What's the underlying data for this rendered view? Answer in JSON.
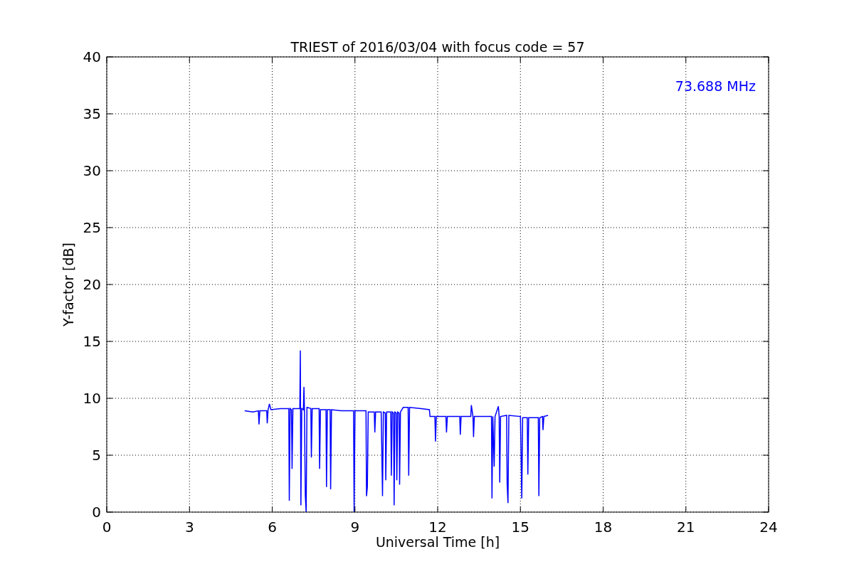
{
  "chart": {
    "chart_data": {
      "type": "line",
      "title": "TRIEST of 2016/03/04 with focus code = 57",
      "xlabel": "Universal Time [h]",
      "ylabel": "Y-factor [dB]",
      "xlim": [
        0,
        24
      ],
      "ylim": [
        0,
        40
      ],
      "xticks": [
        0,
        3,
        6,
        9,
        12,
        15,
        18,
        21,
        24
      ],
      "yticks": [
        0,
        5,
        10,
        15,
        20,
        25,
        30,
        35,
        40
      ],
      "x": [
        5.0,
        5.3,
        5.5,
        5.52,
        5.55,
        5.8,
        5.82,
        5.85,
        5.9,
        5.95,
        6.3,
        6.6,
        6.62,
        6.65,
        6.7,
        6.72,
        6.75,
        7.0,
        7.02,
        7.04,
        7.07,
        7.13,
        7.15,
        7.17,
        7.2,
        7.23,
        7.26,
        7.4,
        7.42,
        7.45,
        7.7,
        7.72,
        7.75,
        7.95,
        7.97,
        8.0,
        8.1,
        8.12,
        8.15,
        8.5,
        8.95,
        8.97,
        9.0,
        9.4,
        9.42,
        9.45,
        9.48,
        9.7,
        9.72,
        9.75,
        9.95,
        9.97,
        10.0,
        10.03,
        10.1,
        10.12,
        10.15,
        10.3,
        10.32,
        10.35,
        10.4,
        10.42,
        10.45,
        10.5,
        10.52,
        10.55,
        10.6,
        10.62,
        10.65,
        10.75,
        10.93,
        10.95,
        10.98,
        11.4,
        11.7,
        11.72,
        11.9,
        11.92,
        11.95,
        12.3,
        12.32,
        12.35,
        12.8,
        12.82,
        12.85,
        13.2,
        13.22,
        13.28,
        13.3,
        13.33,
        13.95,
        13.97,
        14.0,
        14.05,
        14.08,
        14.2,
        14.23,
        14.25,
        14.28,
        14.5,
        14.52,
        14.55,
        14.58,
        15.0,
        15.05,
        15.08,
        15.25,
        15.27,
        15.3,
        15.65,
        15.67,
        15.7,
        15.8,
        15.82,
        15.85,
        16.0
      ],
      "grid": true,
      "series": [
        {
          "name": "73.688 MHz",
          "color": "#0000ff",
          "values": [
            8.9,
            8.8,
            8.9,
            7.7,
            8.9,
            8.9,
            7.8,
            9.0,
            9.5,
            9.0,
            9.1,
            9.1,
            1.0,
            9.1,
            9.0,
            3.8,
            9.1,
            9.1,
            14.2,
            0.6,
            9.1,
            9.0,
            11.0,
            9.0,
            1.5,
            0.0,
            9.2,
            9.1,
            4.8,
            9.1,
            9.1,
            3.8,
            9.0,
            9.0,
            2.2,
            9.0,
            9.0,
            2.0,
            9.0,
            8.9,
            8.9,
            0.0,
            8.9,
            8.9,
            1.4,
            2.2,
            8.8,
            8.8,
            7.0,
            8.8,
            8.8,
            6.2,
            1.4,
            8.8,
            8.7,
            2.8,
            8.8,
            8.8,
            3.2,
            8.8,
            8.7,
            0.6,
            8.8,
            8.7,
            2.8,
            8.8,
            8.7,
            2.4,
            8.8,
            9.2,
            9.2,
            3.2,
            9.2,
            9.1,
            9.0,
            8.4,
            8.4,
            6.2,
            8.4,
            8.4,
            7.0,
            8.4,
            8.4,
            6.8,
            8.4,
            8.4,
            9.4,
            8.4,
            6.6,
            8.4,
            8.4,
            1.2,
            8.4,
            4.0,
            8.4,
            9.3,
            8.4,
            2.6,
            8.4,
            8.5,
            2.5,
            0.8,
            8.5,
            8.4,
            1.2,
            8.3,
            8.3,
            3.3,
            8.3,
            8.3,
            1.4,
            8.3,
            8.4,
            7.2,
            8.4,
            8.5
          ]
        }
      ]
    }
  }
}
